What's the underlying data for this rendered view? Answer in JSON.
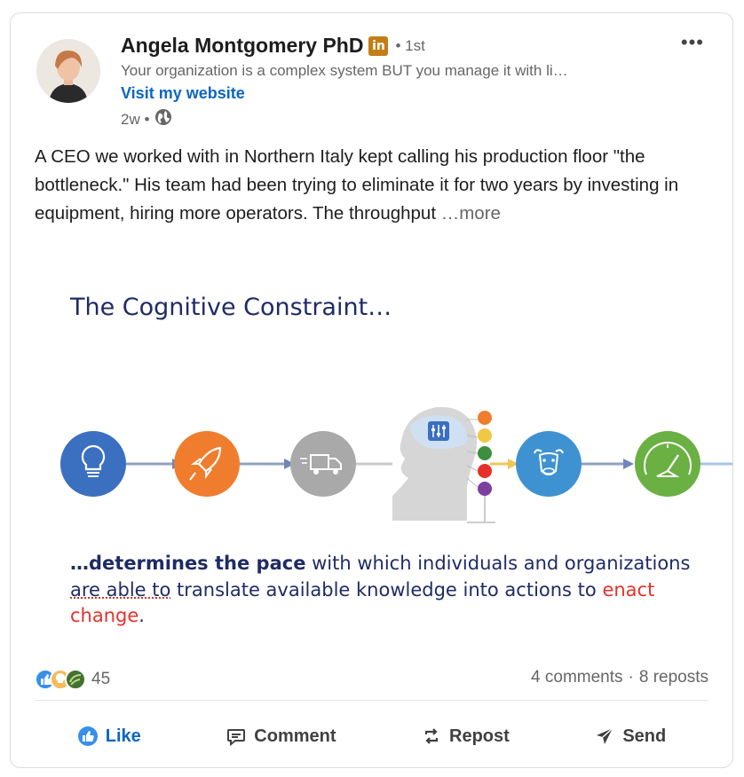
{
  "author": {
    "name": "Angela Montgomery PhD",
    "badge": "in",
    "degree": "• 1st",
    "headline": "Your organization is a complex system BUT you manage it with li…",
    "website_label": "Visit my website",
    "time": "2w •"
  },
  "post": {
    "text": "A CEO we worked with in Northern Italy kept calling his production floor \"the bottleneck.\" His team had been trying to eliminate it for two years by investing in equipment, hiring more operators. The throughput ",
    "more_label": "…more"
  },
  "image": {
    "title": "The Cognitive Constraint…",
    "caption_bold": "…determines the pace",
    "caption_1": " with which individuals and organizations ",
    "caption_underlined": "are able to",
    "caption_2": " translate available knowledge into actions to ",
    "caption_red": "enact change",
    "caption_end": "."
  },
  "social": {
    "reaction_count": "45",
    "comments": "4 comments",
    "separator": "·",
    "reposts": "8 reposts"
  },
  "actions": {
    "like": "Like",
    "comment": "Comment",
    "repost": "Repost",
    "send": "Send"
  },
  "colors": {
    "link_blue": "#0a66c2",
    "diagram_blue": "#3b6fc0",
    "diagram_orange": "#ef7d2d",
    "diagram_gray": "#a9a9a9",
    "diagram_sky": "#3f92d2",
    "diagram_green": "#6ab043"
  },
  "icons": [
    "linkedin-badge-icon",
    "globe-icon",
    "more-icon",
    "lightbulb-icon",
    "rocket-icon",
    "truck-icon",
    "head-icon",
    "bull-icon",
    "gauge-icon",
    "like-icon",
    "comment-icon",
    "repost-icon",
    "send-icon"
  ]
}
